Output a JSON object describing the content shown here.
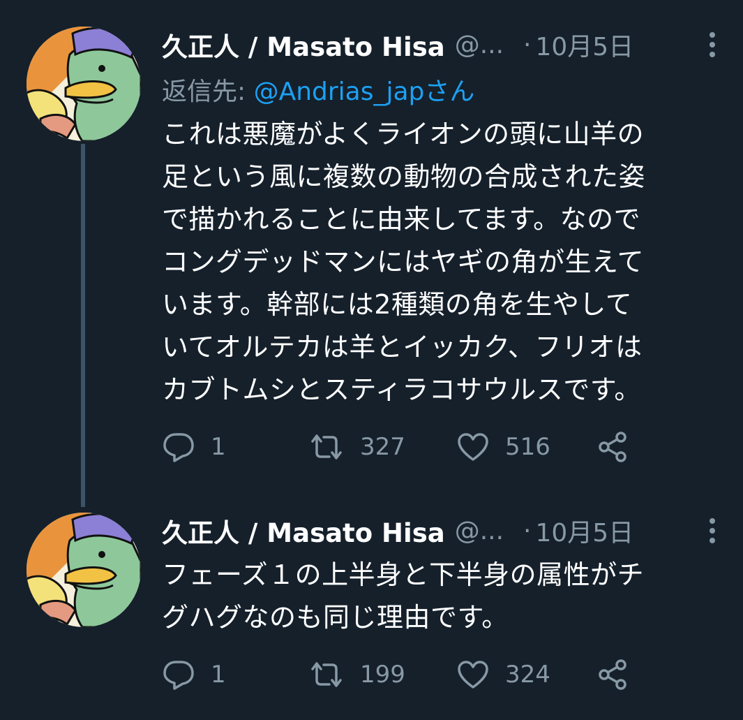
{
  "tweets": [
    {
      "author_name": "久正人 / Masato Hisa",
      "handle": "@...",
      "separator": "·",
      "date": "10月5日",
      "reply_to_label": "返信先: ",
      "reply_to_mention": "@Andrias_japさん",
      "text": "これは悪魔がよくライオンの頭に山羊の\n足という風に複数の動物の合成された姿\nで描かれることに由来してます。なので\nコングデッドマンにはヤギの角が生えて\nいます。幹部には2種類の角を生やして\nいてオルテカは羊とイッカク、フリオは\nカブトムシとスティラコサウルスです。",
      "replies": "1",
      "retweets": "327",
      "likes": "516"
    },
    {
      "author_name": "久正人 / Masato Hisa",
      "handle": "@...",
      "separator": "·",
      "date": "10月5日",
      "text": "フェーズ１の上半身と下半身の属性がチ\nグハグなのも同じ理由です。",
      "replies": "1",
      "retweets": "199",
      "likes": "324"
    }
  ],
  "colors": {
    "background": "#15202b",
    "text": "#ffffff",
    "secondary": "#8899a6",
    "link": "#1da1f2",
    "thread_line": "#3d5466"
  },
  "icons": [
    "more-vertical-icon",
    "reply-icon",
    "retweet-icon",
    "like-icon",
    "share-icon"
  ]
}
